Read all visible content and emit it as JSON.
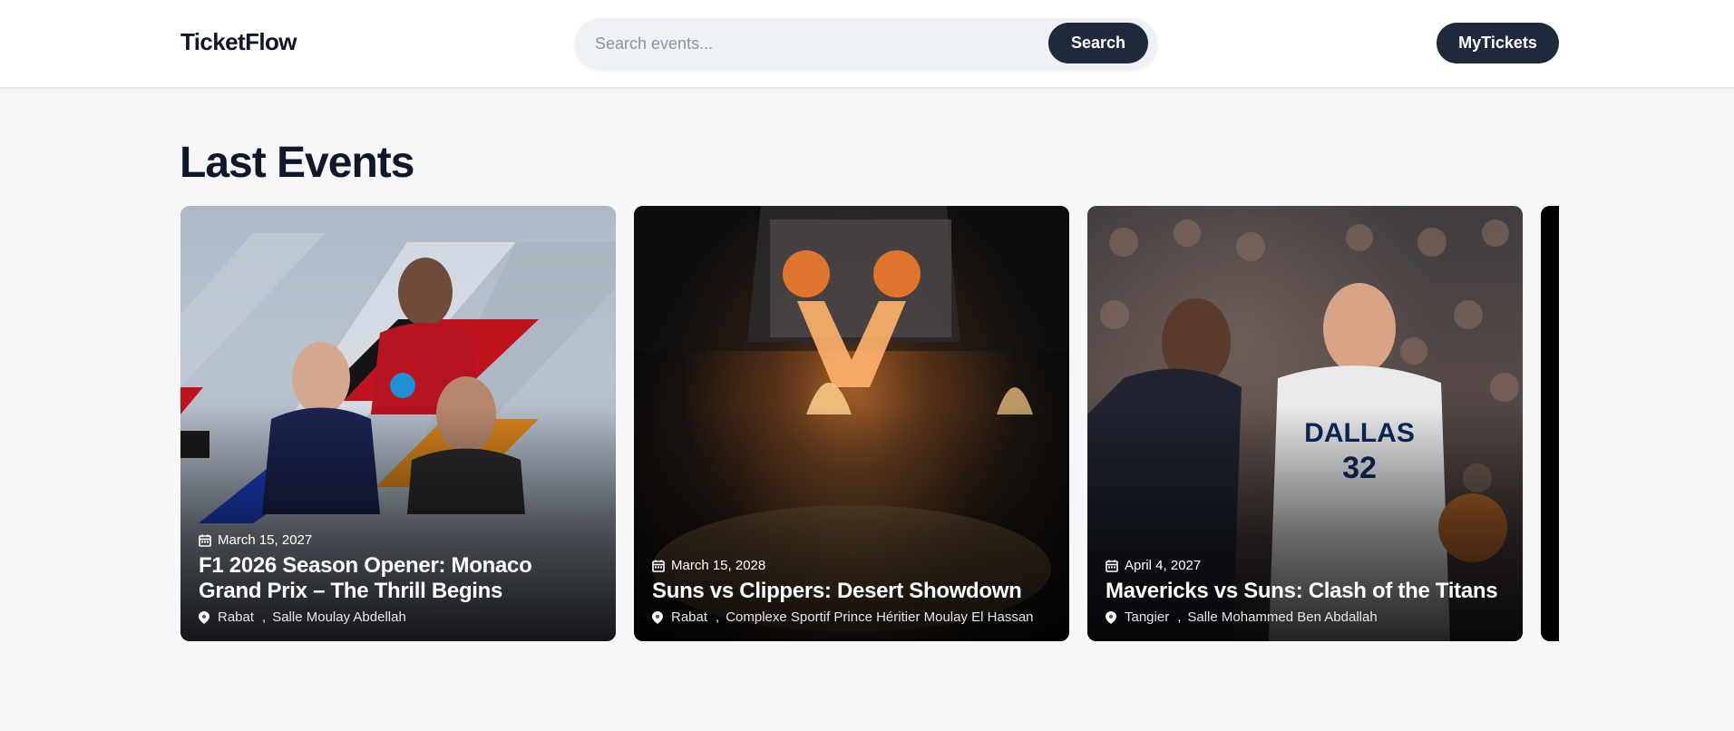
{
  "header": {
    "logo": "TicketFlow",
    "search_placeholder": "Search events...",
    "search_button": "Search",
    "mytickets_button": "MyTickets"
  },
  "section": {
    "title": "Last Events"
  },
  "events": [
    {
      "date": "March 15, 2027",
      "title": "F1 2026 Season Opener: Monaco Grand Prix – The Thrill Begins",
      "city": "Rabat",
      "venue": "Salle Moulay Abdellah"
    },
    {
      "date": "March 15, 2028",
      "title": "Suns vs Clippers: Desert Showdown",
      "city": "Rabat",
      "venue": "Complexe Sportif Prince Héritier Moulay El Hassan"
    },
    {
      "date": "April 4, 2027",
      "title": "Mavericks vs Suns: Clash of the Titans",
      "city": "Tangier",
      "venue": "Salle Mohammed Ben Abdallah"
    }
  ],
  "icons": {
    "date": "calendar-icon",
    "location": "map-pin-icon"
  },
  "colors": {
    "primary": "#1e293b",
    "page_bg": "#f6f7f9",
    "header_bg": "#ffffff",
    "search_bg": "#eef1f6"
  }
}
